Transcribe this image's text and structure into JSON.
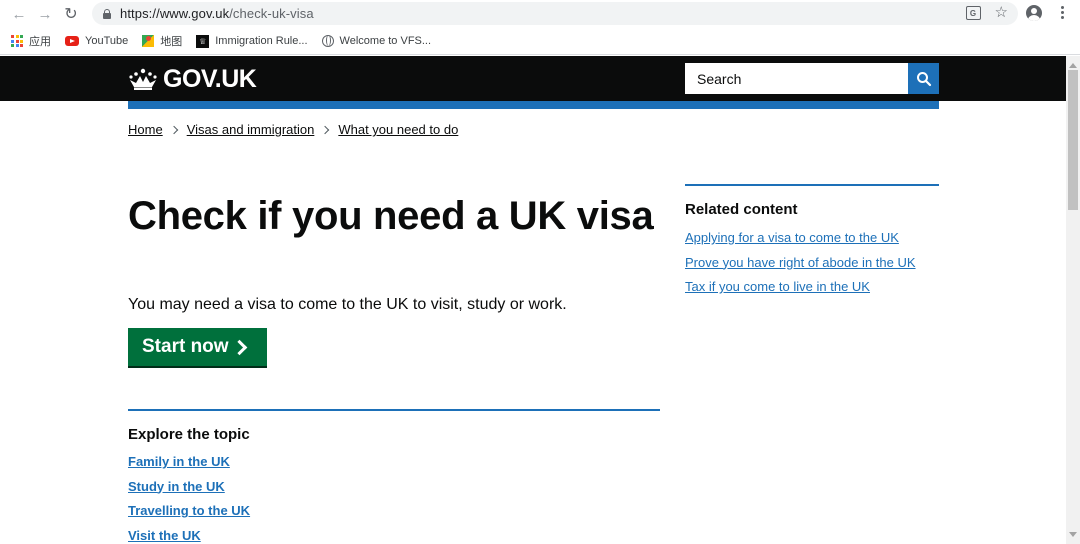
{
  "browser": {
    "url_host": "https://www.gov.uk",
    "url_path": "/check-uk-visa",
    "bookmarks": [
      {
        "label": "应用",
        "icon": "apps-grid-icon"
      },
      {
        "label": "YouTube",
        "icon": "youtube-icon"
      },
      {
        "label": "地图",
        "icon": "maps-icon"
      },
      {
        "label": "Immigration Rule...",
        "icon": "gov-favicon-icon"
      },
      {
        "label": "Welcome to VFS...",
        "icon": "globe-icon"
      }
    ]
  },
  "header": {
    "logo_text": "GOV.UK",
    "search_placeholder": "Search"
  },
  "breadcrumbs": [
    "Home",
    "Visas and immigration",
    "What you need to do"
  ],
  "main": {
    "title": "Check if you need a UK visa",
    "lede": "You may need a visa to come to the UK to visit, study or work.",
    "start_button": "Start now"
  },
  "explore": {
    "heading": "Explore the topic",
    "links": [
      "Family in the UK",
      "Study in the UK",
      "Travelling to the UK",
      "Visit the UK"
    ]
  },
  "related": {
    "heading": "Related content",
    "links": [
      "Applying for a visa to come to the UK",
      "Prove you have right of abode in the UK",
      "Tax if you come to live in the UK"
    ]
  },
  "colors": {
    "header_bg": "#0b0c0c",
    "brand_blue": "#1d70b8",
    "start_green": "#00703c"
  }
}
